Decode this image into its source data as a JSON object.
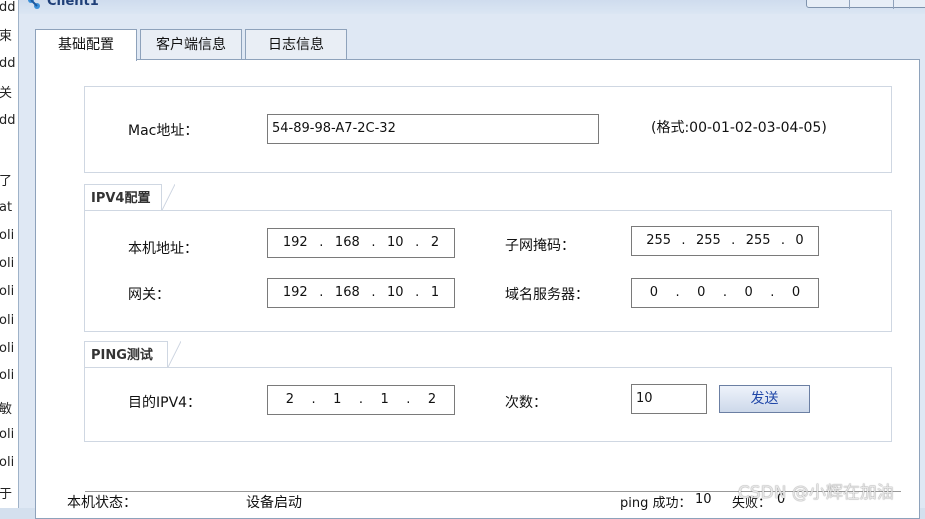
{
  "background_fragments": [
    "dd",
    "束",
    "dd",
    "关",
    "dd",
    "了",
    "at",
    "oli",
    "oli",
    "oli",
    "oli",
    "oli",
    "oli",
    "敏",
    "oli",
    "oli",
    "于"
  ],
  "window": {
    "title": "Client1",
    "icon": "network-icon"
  },
  "tabs": [
    {
      "label": "基础配置",
      "active": true
    },
    {
      "label": "客户端信息",
      "active": false
    },
    {
      "label": "日志信息",
      "active": false
    }
  ],
  "mac": {
    "label": "Mac地址：",
    "value": "54-89-98-A7-2C-32",
    "hint": "(格式:00-01-02-03-04-05)"
  },
  "ipv4": {
    "section_title": "IPV4配置",
    "local_label": "本机地址：",
    "local": [
      "192",
      "168",
      "10",
      "2"
    ],
    "mask_label": "子网掩码：",
    "mask": [
      "255",
      "255",
      "255",
      "0"
    ],
    "gateway_label": "网关：",
    "gateway": [
      "192",
      "168",
      "10",
      "1"
    ],
    "dns_label": "域名服务器：",
    "dns": [
      "0",
      "0",
      "0",
      "0"
    ]
  },
  "ping": {
    "section_title": "PING测试",
    "target_label": "目的IPV4：",
    "target": [
      "2",
      "1",
      "1",
      "2"
    ],
    "count_label": "次数：",
    "count": "10",
    "send_label": "发送"
  },
  "status": {
    "label": "本机状态：",
    "value": "设备启动",
    "success_label": "ping 成功：",
    "success_count": "10",
    "fail_label": "失败：",
    "fail_count": "0"
  },
  "watermark": "CSDN @小辉在加油",
  "colors": {
    "accent": "#1f3f78",
    "window_bg": "#dfe8f4",
    "button_text": "#2047a8"
  }
}
